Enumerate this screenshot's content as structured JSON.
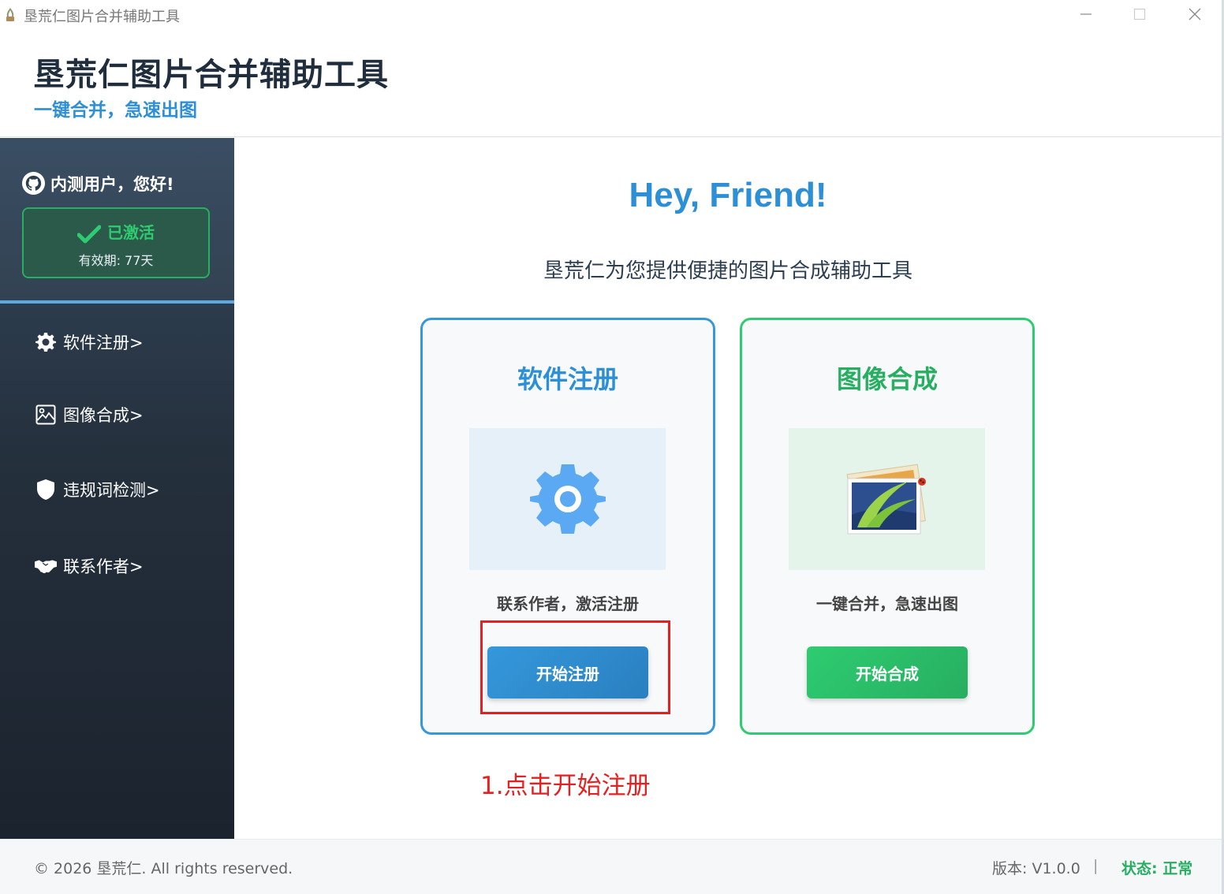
{
  "window": {
    "title": "垦荒仁图片合并辅助工具",
    "controls": [
      "minimize-icon",
      "maximize-icon",
      "close-icon"
    ]
  },
  "header": {
    "app_name": "垦荒仁图片合并辅助工具",
    "slogan": "一键合并，急速出图"
  },
  "sidebar": {
    "user_greeting": "内测用户，您好!",
    "user_icon": "github-icon",
    "activation": {
      "status": "已激活",
      "validity": "有效期: 77天"
    },
    "items": [
      {
        "label": "软件注册>",
        "icon": "gear-icon"
      },
      {
        "label": "图像合成>",
        "icon": "image-icon"
      },
      {
        "label": "违规词检测>",
        "icon": "shield-icon"
      },
      {
        "label": "联系作者>",
        "icon": "handshake-icon"
      }
    ]
  },
  "main": {
    "greeting": "Hey, Friend!",
    "lead": "垦荒仁为您提供便捷的图片合成辅助工具",
    "cards": [
      {
        "title": "软件注册",
        "description": "联系作者，激活注册",
        "button": "开始注册",
        "icon": "gear-icon"
      },
      {
        "title": "图像合成",
        "description": "一键合并，急速出图",
        "button": "开始合成",
        "icon": "photo-icon"
      }
    ],
    "annotation": "1.点击开始注册"
  },
  "footer": {
    "copyright": "© 2026 垦荒仁. All rights reserved.",
    "version": "版本: V1.0.0",
    "separator": "|",
    "state": "状态: 正常"
  },
  "colors": {
    "primary_blue": "#2d8fd5",
    "green": "#27ae60",
    "sidebar_dark": "#1b232e",
    "annotation_red": "#e52020"
  }
}
